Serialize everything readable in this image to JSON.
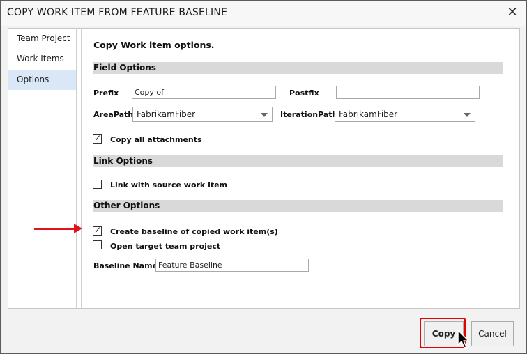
{
  "dialog": {
    "title": "COPY WORK ITEM FROM FEATURE BASELINE",
    "close_glyph": "✕"
  },
  "nav": {
    "items": [
      {
        "label": "Team Project",
        "selected": false
      },
      {
        "label": "Work Items",
        "selected": false
      },
      {
        "label": "Options",
        "selected": true
      }
    ]
  },
  "main": {
    "heading": "Copy Work item options.",
    "field_options": {
      "title": "Field Options",
      "prefix_label": "Prefix",
      "prefix_value": "Copy of",
      "postfix_label": "Postfix",
      "postfix_value": "",
      "areapath_label": "AreaPath",
      "areapath_value": "FabrikamFiber",
      "iterationpath_label": "IterationPath",
      "iterationpath_value": "FabrikamFiber",
      "copy_attachments_label": "Copy all attachments",
      "copy_attachments_checked": true
    },
    "link_options": {
      "title": "Link Options",
      "link_source_label": "Link with source work item",
      "link_source_checked": false
    },
    "other_options": {
      "title": "Other Options",
      "create_baseline_label": "Create baseline of copied work item(s)",
      "create_baseline_checked": true,
      "open_target_label": "Open target team project",
      "open_target_checked": false,
      "baseline_name_label": "Baseline Name",
      "baseline_name_value": "Feature Baseline"
    }
  },
  "footer": {
    "copy_label": "Copy",
    "cancel_label": "Cancel"
  },
  "colors": {
    "annotation_red": "#e4131b",
    "nav_selected": "#d9e7f7",
    "section_bar": "#d9d9d9"
  },
  "check_glyph": "✓"
}
